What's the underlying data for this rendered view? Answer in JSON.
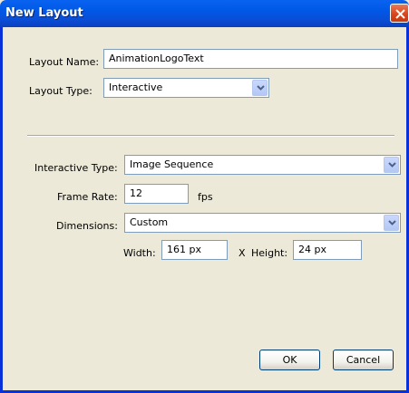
{
  "window": {
    "title": "New Layout"
  },
  "form": {
    "layout_name_label": "Layout Name:",
    "layout_name_value": "AnimationLogoText",
    "layout_type_label": "Layout Type:",
    "layout_type_value": "Interactive",
    "interactive_type_label": "Interactive Type:",
    "interactive_type_value": "Image Sequence",
    "frame_rate_label": "Frame Rate:",
    "frame_rate_value": "12",
    "frame_rate_unit": "fps",
    "dimensions_label": "Dimensions:",
    "dimensions_value": "Custom",
    "width_label": "Width:",
    "width_value": "161 px",
    "times_symbol": "X",
    "height_label": "Height:",
    "height_value": "24 px"
  },
  "buttons": {
    "ok": "OK",
    "cancel": "Cancel"
  },
  "colors": {
    "titlebar": "#0058e6",
    "close": "#d8481f",
    "dialog_bg": "#ece9d8",
    "field_border": "#7f9db9"
  },
  "icons": {
    "close": "close-icon",
    "dropdown": "chevron-down-icon"
  }
}
